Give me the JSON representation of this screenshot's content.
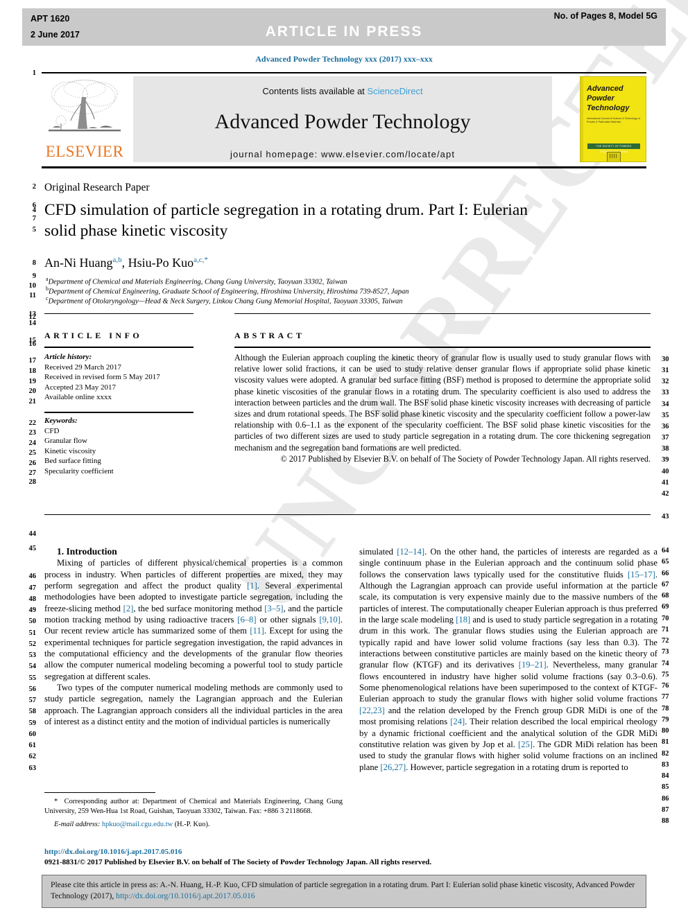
{
  "running_head": {
    "left_line1": "APT 1620",
    "left_line2": "2 June 2017",
    "center": "ARTICLE  IN  PRESS",
    "right": "No. of Pages 8, Model 5G"
  },
  "journal_line": "Advanced Powder Technology xxx (2017) xxx–xxx",
  "masthead": {
    "publisher_logo_text": "ELSEVIER",
    "contents_prefix": "Contents lists available at ",
    "contents_link": "ScienceDirect",
    "journal_title": "Advanced Powder Technology",
    "homepage": "journal homepage: www.elsevier.com/locate/apt",
    "cover": {
      "line1": "Advanced",
      "line2": "Powder",
      "line3": "Technology",
      "subtitle": "International Journal of Science & Technology of Powder & Particulate Materials",
      "banner": "THE SOCIETY OF POWDER TECHNOLOGY JAPAN"
    }
  },
  "article": {
    "type": "Original Research Paper",
    "title_line1": "CFD simulation of particle segregation in a rotating drum. Part I: Eulerian",
    "title_line2": "solid phase kinetic viscosity",
    "authors": [
      {
        "name": "An-Ni Huang",
        "sup": "a,b"
      },
      {
        "name": "Hsiu-Po Kuo",
        "sup": "a,c,*"
      }
    ],
    "affiliations": [
      {
        "sup": "a",
        "text": "Department of Chemical and Materials Engineering, Chang Gung University, Taoyuan 33302, Taiwan"
      },
      {
        "sup": "b",
        "text": "Department of Chemical Engineering, Graduate School of Engineering, Hiroshima University, Hiroshima 739-8527, Japan"
      },
      {
        "sup": "c",
        "text": "Department of Otolaryngology—Head & Neck Surgery, Linkou Chang Gung Memorial Hospital, Taoyuan 33305, Taiwan"
      }
    ]
  },
  "article_info": {
    "heading": "ARTICLE INFO",
    "history_label": "Article history:",
    "history": [
      "Received 29 March 2017",
      "Received in revised form 5 May 2017",
      "Accepted 23 May 2017",
      "Available online xxxx"
    ],
    "keywords_label": "Keywords:",
    "keywords": [
      "CFD",
      "Granular flow",
      "Kinetic viscosity",
      "Bed surface fitting",
      "Specularity coefficient"
    ]
  },
  "abstract": {
    "heading": "ABSTRACT",
    "body": "Although the Eulerian approach coupling the kinetic theory of granular flow is usually used to study granular flows with relative lower solid fractions, it can be used to study relative denser granular flows if appropriate solid phase kinetic viscosity values were adopted. A granular bed surface fitting (BSF) method is proposed to determine the appropriate solid phase kinetic viscosities of the granular flows in a rotating drum. The specularity coefficient is also used to address the interaction between particles and the drum wall. The BSF solid phase kinetic viscosity increases with decreasing of particle sizes and drum rotational speeds. The BSF solid phase kinetic viscosity and the specularity coefficient follow a power-law relationship with 0.6–1.1 as the exponent of the specularity coefficient. The BSF solid phase kinetic viscosities for the particles of two different sizes are used to study particle segregation in a rotating drum. The core thickening segregation mechanism and the segregation band formations are well predicted.",
    "copyright": "© 2017 Published by Elsevier B.V. on behalf of The Society of Powder Technology Japan. All rights reserved."
  },
  "body": {
    "section_title": "1. Introduction",
    "left_paragraphs": [
      "Mixing of particles of different physical/chemical properties is a common process in industry. When particles of different properties are mixed, they may perform segregation and affect the product quality [1]. Several experimental methodologies have been adopted to investigate particle segregation, including the freeze-slicing method [2], the bed surface monitoring method [3–5], and the particle motion tracking method by using radioactive tracers [6–8] or other signals [9,10]. Our recent review article has summarized some of them [11]. Except for using the experimental techniques for particle segregation investigation, the rapid advances in the computational efficiency and the developments of the granular flow theories allow the computer numerical modeling becoming a powerful tool to study particle segregation at different scales.",
      "Two types of the computer numerical modeling methods are commonly used to study particle segregation, namely the Lagrangian approach and the Eulerian approach. The Lagrangian approach considers all the individual particles in the area of interest as a distinct entity and the motion of individual particles is numerically"
    ],
    "right_paragraphs": [
      "simulated [12–14]. On the other hand, the particles of interests are regarded as a single continuum phase in the Eulerian approach and the continuum solid phase follows the conservation laws typically used for the constitutive fluids [15–17]. Although the Lagrangian approach can provide useful information at the particle scale, its computation is very expensive mainly due to the massive numbers of the particles of interest. The computationally cheaper Eulerian approach is thus preferred in the large scale modeling [18] and is used to study particle segregation in a rotating drum in this work. The granular flows studies using the Eulerian approach are typically rapid and have lower solid volume fractions (say less than 0.3). The interactions between constitutive particles are mainly based on the kinetic theory of granular flow (KTGF) and its derivatives [19–21]. Nevertheless, many granular flows encountered in industry have higher solid volume fractions (say 0.3–0.6). Some phenomenological relations have been superimposed to the context of KTGF-Eulerian approach to study the granular flows with higher solid volume fractions [22,23] and the relation developed by the French group GDR MiDi is one of the most promising relations [24]. Their relation described the local empirical rheology by a dynamic frictional coefficient and the analytical solution of the GDR MiDi constitutive relation was given by Jop et al. [25]. The GDR MiDi relation has been used to study the granular flows with higher solid volume fractions on an inclined plane [26,27]. However, particle segregation in a rotating drum is reported to"
    ]
  },
  "footnote": {
    "star": "*",
    "corresponding": "Corresponding author at: Department of Chemical and Materials Engineering, Chang Gung University, 259 Wen-Hua 1st Road, Guishan, Taoyuan 33302, Taiwan. Fax: +886 3 2118668.",
    "email_label": "E-mail address:",
    "email": "hpkuo@mail.cgu.edu.tw",
    "email_suffix": "(H.-P. Kuo)."
  },
  "doi_block": {
    "doi": "http://dx.doi.org/10.1016/j.apt.2017.05.016",
    "issn_line": "0921-8831/© 2017 Published by Elsevier B.V. on behalf of The Society of Powder Technology Japan. All rights reserved."
  },
  "citation": {
    "text_before": "Please cite this article in press as: A.-N. Huang, H.-P. Kuo, CFD simulation of particle segregation in a rotating drum. Part I: Eulerian solid phase kinetic viscosity, Advanced Powder Technology (2017), ",
    "link": "http://dx.doi.org/10.1016/j.apt.2017.05.016"
  },
  "line_numbers": {
    "left": [
      "1",
      "2",
      "6",
      "4",
      "7",
      "5",
      "8",
      "9",
      "10",
      "11",
      "13",
      "12",
      "14",
      "15",
      "16",
      "17",
      "18",
      "19",
      "20",
      "21",
      "22",
      "23",
      "24",
      "25",
      "26",
      "27",
      "28",
      "44",
      "45",
      "46",
      "47",
      "48",
      "49",
      "50",
      "51",
      "52",
      "53",
      "54",
      "55",
      "56",
      "57",
      "58",
      "59",
      "60",
      "61",
      "62",
      "63"
    ],
    "right": [
      "30",
      "31",
      "32",
      "33",
      "34",
      "35",
      "36",
      "37",
      "38",
      "39",
      "40",
      "41",
      "42",
      "43",
      "64",
      "65",
      "66",
      "67",
      "68",
      "69",
      "70",
      "71",
      "72",
      "73",
      "74",
      "75",
      "76",
      "77",
      "78",
      "79",
      "80",
      "81",
      "82",
      "83",
      "84",
      "85",
      "86",
      "87",
      "88"
    ]
  },
  "colors": {
    "link": "#1b6f9e",
    "sciencedirect": "#3f9fd4",
    "elsevier_orange": "#e87722",
    "cover_yellow": "#f2e313",
    "header_gray": "#c9c9c9"
  }
}
